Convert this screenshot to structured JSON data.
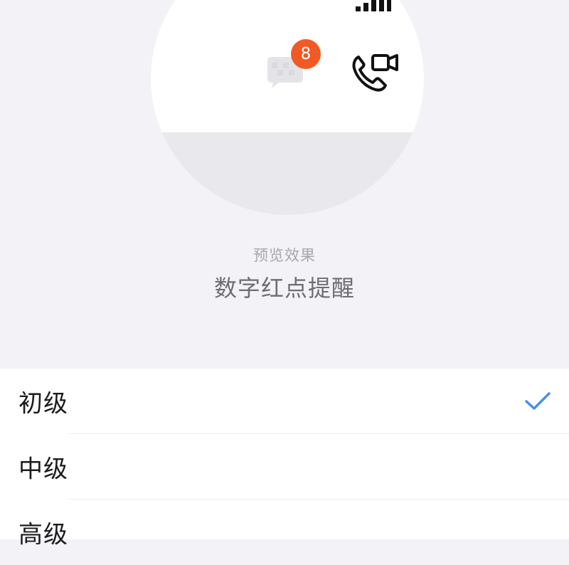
{
  "preview": {
    "badge_count": "8",
    "caption": "预览效果",
    "mode_title": "数字红点提醒",
    "icons": {
      "signal": "signal-bars-icon",
      "chat": "chat-bubble-icon",
      "call": "video-call-icon"
    }
  },
  "options": [
    {
      "label": "初级",
      "selected": true
    },
    {
      "label": "中级",
      "selected": false
    },
    {
      "label": "高级",
      "selected": false
    }
  ],
  "colors": {
    "badge": "#f15a24",
    "check": "#4a90e2",
    "background": "#f2f2f7"
  }
}
